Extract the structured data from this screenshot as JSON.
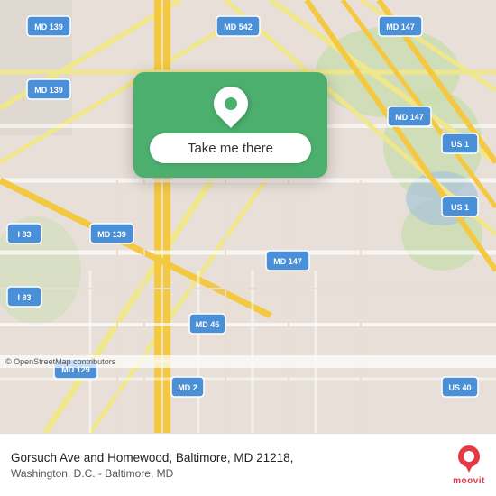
{
  "map": {
    "alt": "Street map of Baltimore MD area",
    "popup": {
      "button_label": "Take me there"
    },
    "attribution": "© OpenStreetMap contributors"
  },
  "bottom_bar": {
    "address": "Gorsuch Ave and Homewood, Baltimore, MD 21218,",
    "subtitle": "Washington, D.C. - Baltimore, MD",
    "logo_text": "moovit"
  },
  "highway_labels": [
    {
      "id": "md139_1",
      "text": "MD 139"
    },
    {
      "id": "md139_2",
      "text": "MD 139"
    },
    {
      "id": "md139_3",
      "text": "MD 139"
    },
    {
      "id": "md542",
      "text": "MD 542"
    },
    {
      "id": "md147_1",
      "text": "MD 147"
    },
    {
      "id": "md147_2",
      "text": "MD 147"
    },
    {
      "id": "md147_3",
      "text": "MD 147"
    },
    {
      "id": "us1_1",
      "text": "US 1"
    },
    {
      "id": "us1_2",
      "text": "US 1"
    },
    {
      "id": "i83_1",
      "text": "I 83"
    },
    {
      "id": "i83_2",
      "text": "I 83"
    },
    {
      "id": "md45",
      "text": "MD 45"
    },
    {
      "id": "md129",
      "text": "MD 129"
    },
    {
      "id": "md2",
      "text": "MD 2"
    },
    {
      "id": "us40",
      "text": "US 40"
    }
  ]
}
